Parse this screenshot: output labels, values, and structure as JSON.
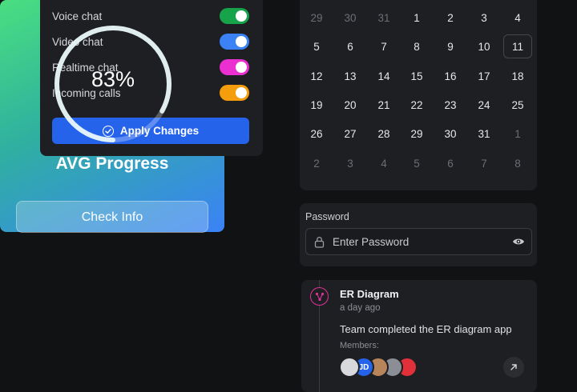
{
  "settings": {
    "toggles": [
      {
        "label": "Voice chat",
        "color": "#16a34a",
        "on": true
      },
      {
        "label": "Video chat",
        "color": "#3b82f6",
        "on": true
      },
      {
        "label": "Realtime chat",
        "color": "#ec2fd0",
        "on": true
      },
      {
        "label": "Incoming calls",
        "color": "#f59e0b",
        "on": true
      }
    ],
    "apply_label": "Apply Changes"
  },
  "progress": {
    "value_text": "83%",
    "value": 0.83,
    "title": "AVG Progress",
    "button_label": "Check Info"
  },
  "calendar": {
    "weeks": [
      [
        {
          "d": "29",
          "m": true
        },
        {
          "d": "30",
          "m": true
        },
        {
          "d": "31",
          "m": true
        },
        {
          "d": "1"
        },
        {
          "d": "2"
        },
        {
          "d": "3"
        },
        {
          "d": "4"
        }
      ],
      [
        {
          "d": "5"
        },
        {
          "d": "6"
        },
        {
          "d": "7"
        },
        {
          "d": "8"
        },
        {
          "d": "9"
        },
        {
          "d": "10"
        },
        {
          "d": "11",
          "today": true
        }
      ],
      [
        {
          "d": "12"
        },
        {
          "d": "13"
        },
        {
          "d": "14"
        },
        {
          "d": "15"
        },
        {
          "d": "16"
        },
        {
          "d": "17"
        },
        {
          "d": "18"
        }
      ],
      [
        {
          "d": "19"
        },
        {
          "d": "20"
        },
        {
          "d": "21"
        },
        {
          "d": "22"
        },
        {
          "d": "23"
        },
        {
          "d": "24"
        },
        {
          "d": "25"
        }
      ],
      [
        {
          "d": "26"
        },
        {
          "d": "27"
        },
        {
          "d": "28"
        },
        {
          "d": "29"
        },
        {
          "d": "30"
        },
        {
          "d": "31"
        },
        {
          "d": "1",
          "m": true
        }
      ],
      [
        {
          "d": "2",
          "m": true
        },
        {
          "d": "3",
          "m": true
        },
        {
          "d": "4",
          "m": true
        },
        {
          "d": "5",
          "m": true
        },
        {
          "d": "6",
          "m": true
        },
        {
          "d": "7",
          "m": true
        },
        {
          "d": "8",
          "m": true
        }
      ]
    ]
  },
  "password": {
    "label": "Password",
    "placeholder": "Enter Password"
  },
  "timeline": {
    "title": "ER Diagram",
    "time": "a day ago",
    "description": "Team completed the ER diagram app",
    "members_label": "Members:",
    "members": [
      {
        "initials": "",
        "color": "#d7d9dc"
      },
      {
        "initials": "JD",
        "color": "#2563eb"
      },
      {
        "initials": "",
        "color": "#b8855a"
      },
      {
        "initials": "",
        "color": "#8b8e95"
      },
      {
        "initials": "",
        "color": "#e0303a"
      }
    ]
  }
}
